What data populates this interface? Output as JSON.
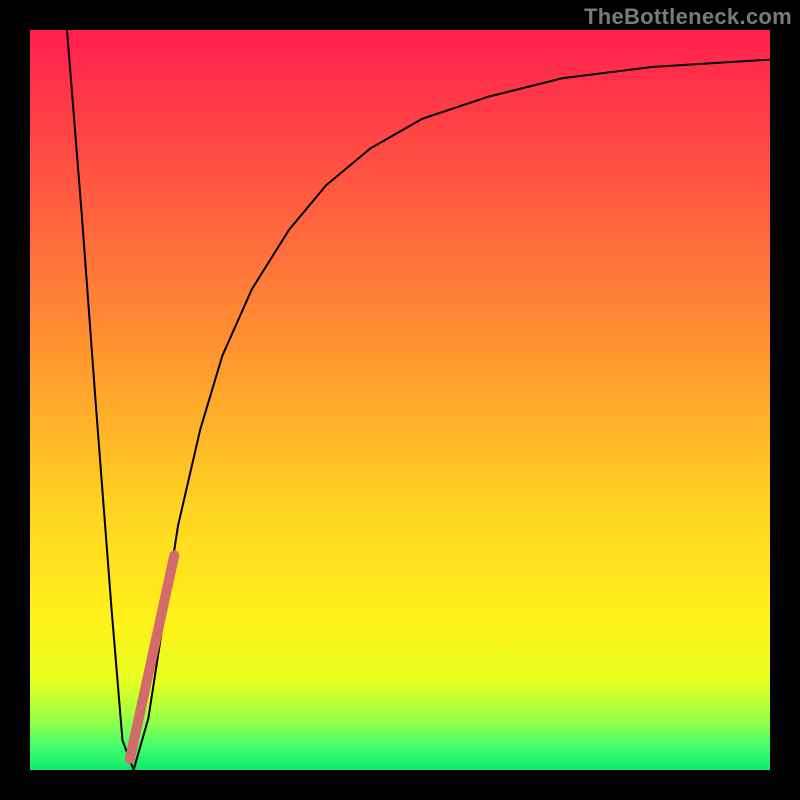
{
  "watermark": "TheBottleneck.com",
  "chart_data": {
    "type": "line",
    "title": "",
    "xlabel": "",
    "ylabel": "",
    "xlim": [
      0,
      100
    ],
    "ylim": [
      0,
      100
    ],
    "grid": false,
    "legend": false,
    "background_gradient": {
      "orientation": "vertical",
      "stops": [
        {
          "pos": 0,
          "color": "#ff1f4f"
        },
        {
          "pos": 45,
          "color": "#ff9a2e"
        },
        {
          "pos": 80,
          "color": "#fff21a"
        },
        {
          "pos": 100,
          "color": "#14e86e"
        }
      ]
    },
    "series": [
      {
        "name": "bottleneck-curve",
        "stroke": "#000000",
        "stroke_width": 2,
        "x": [
          5,
          7,
          9,
          11,
          12.5,
          14,
          16,
          18,
          20,
          23,
          26,
          30,
          35,
          40,
          46,
          53,
          62,
          72,
          84,
          100
        ],
        "y": [
          100,
          75,
          48,
          22,
          4,
          0,
          7,
          20,
          33,
          46,
          56,
          65,
          73,
          79,
          84,
          88,
          91,
          93.5,
          95,
          96
        ]
      },
      {
        "name": "highlight-segment",
        "stroke": "#d46b6b",
        "stroke_width": 10,
        "linecap": "round",
        "x": [
          13.5,
          19.5
        ],
        "y": [
          1.5,
          29
        ]
      }
    ]
  }
}
